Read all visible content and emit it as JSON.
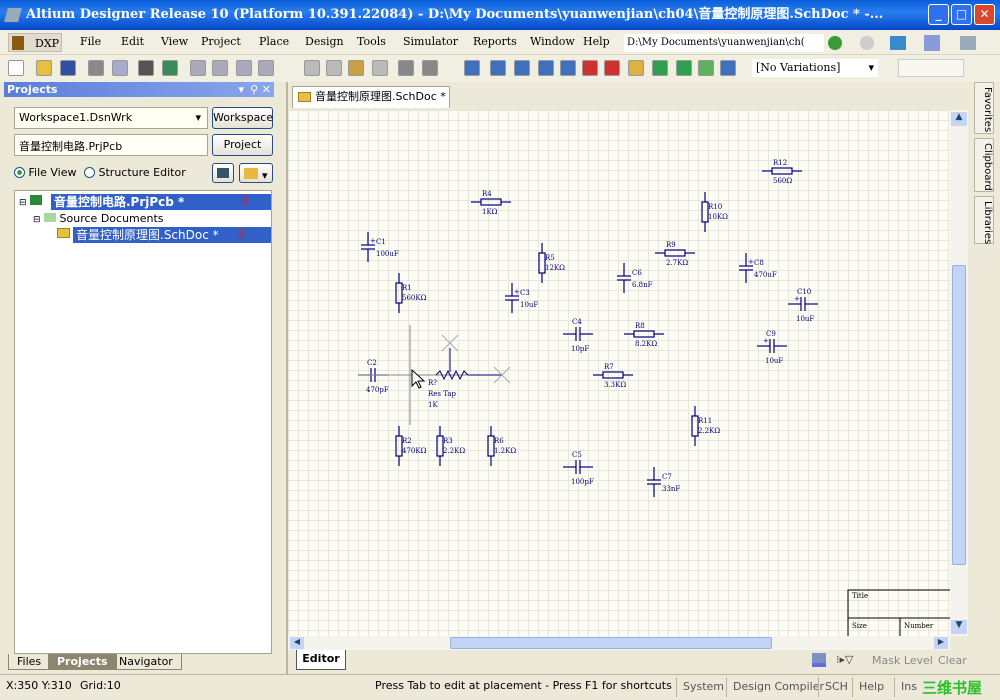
{
  "window": {
    "title": "Altium Designer Release 10 (Platform 10.391.22084) - D:\\My Documents\\yuanwenjian\\ch04\\音量控制原理图.SchDoc * -..."
  },
  "menu": {
    "dxp": "DXP",
    "items": [
      "File",
      "Edit",
      "View",
      "Project",
      "Place",
      "Design",
      "Tools",
      "Simulator",
      "Reports",
      "Window",
      "Help"
    ],
    "path": "D:\\My Documents\\yuanwenjian\\ch("
  },
  "toolbar": {
    "icons": [
      "new-icon",
      "open-icon",
      "save-icon",
      "print-icon",
      "print-preview-icon",
      "3d-icon",
      "board-icon",
      "zoom-fit-icon",
      "zoom-area-icon",
      "zoom-selected-icon",
      "filter-icon",
      "cut-icon",
      "copy-icon",
      "paste-icon",
      "rubber-stamp-icon",
      "select-area-icon",
      "move-icon",
      "wire-icon",
      "bus-icon",
      "bus-entry-icon",
      "net-label-icon",
      "net-icon",
      "gnd-icon",
      "vcc-icon",
      "part-icon",
      "sheet-symbol-icon",
      "sheet-entry-icon",
      "device-sheet-icon",
      "port-icon"
    ],
    "variations": "[No Variations]"
  },
  "projects_panel": {
    "title": "Projects",
    "workspace": "Workspace1.DsnWrk",
    "workspace_btn": "Workspace",
    "project": "音量控制电路.PrjPcb",
    "project_btn": "Project",
    "file_view": "File View",
    "structure_editor": "Structure Editor",
    "tree": {
      "project": "音量控制电路.PrjPcb *",
      "folder": "Source Documents",
      "doc": "音量控制原理图.SchDoc *"
    },
    "tabs": [
      "Files",
      "Projects",
      "Navigator"
    ]
  },
  "document_tab": "音量控制原理图.SchDoc *",
  "side_tabs": [
    "Favorites",
    "Clipboard",
    "Libraries"
  ],
  "schematic": {
    "wire_color": "#000080",
    "components": [
      {
        "ref": "R12",
        "value": "560Ω",
        "type": "resistor",
        "orientation": "h"
      },
      {
        "ref": "R4",
        "value": "1KΩ",
        "type": "resistor",
        "orientation": "h"
      },
      {
        "ref": "R10",
        "value": "10KΩ",
        "type": "resistor",
        "orientation": "v"
      },
      {
        "ref": "C1",
        "value": "100uF",
        "type": "capacitor",
        "orientation": "v",
        "polarized": true
      },
      {
        "ref": "R5",
        "value": "12KΩ",
        "type": "resistor",
        "orientation": "v"
      },
      {
        "ref": "R9",
        "value": "2.7KΩ",
        "type": "resistor",
        "orientation": "h"
      },
      {
        "ref": "C8",
        "value": "470uF",
        "type": "capacitor",
        "orientation": "v",
        "polarized": true
      },
      {
        "ref": "C6",
        "value": "6.8nF",
        "type": "capacitor",
        "orientation": "v",
        "polarized": false
      },
      {
        "ref": "R1",
        "value": "560KΩ",
        "type": "resistor",
        "orientation": "v"
      },
      {
        "ref": "C3",
        "value": "10uF",
        "type": "capacitor",
        "orientation": "v",
        "polarized": true
      },
      {
        "ref": "C10",
        "value": "10uF",
        "type": "capacitor",
        "orientation": "h",
        "polarized": true
      },
      {
        "ref": "C4",
        "value": "10pF",
        "type": "capacitor",
        "orientation": "h",
        "polarized": false
      },
      {
        "ref": "R8",
        "value": "8.2KΩ",
        "type": "resistor",
        "orientation": "h"
      },
      {
        "ref": "C9",
        "value": "10uF",
        "type": "capacitor",
        "orientation": "h",
        "polarized": true
      },
      {
        "ref": "C2",
        "value": "470pF",
        "type": "capacitor",
        "orientation": "h",
        "polarized": false
      },
      {
        "ref": "R7",
        "value": "3.3KΩ",
        "type": "resistor",
        "orientation": "h"
      },
      {
        "ref": "R11",
        "value": "2.2KΩ",
        "type": "resistor",
        "orientation": "v"
      },
      {
        "ref": "R2",
        "value": "470KΩ",
        "type": "resistor",
        "orientation": "v"
      },
      {
        "ref": "R3",
        "value": "2.2KΩ",
        "type": "resistor",
        "orientation": "v"
      },
      {
        "ref": "R6",
        "value": "1.2KΩ",
        "type": "resistor",
        "orientation": "v"
      },
      {
        "ref": "C5",
        "value": "100pF",
        "type": "capacitor",
        "orientation": "h",
        "polarized": false
      },
      {
        "ref": "C7",
        "value": "33nF",
        "type": "capacitor",
        "orientation": "v",
        "polarized": false
      }
    ],
    "floating_part": {
      "ref": "R?",
      "name": "Res Tap",
      "value": "1K"
    },
    "title_block": {
      "title": "Title",
      "size": "Size",
      "number": "Number"
    }
  },
  "editor_row": {
    "tab": "Editor",
    "mask_level": "Mask Level",
    "clear": "Clear"
  },
  "status": {
    "coords": "X:350 Y:310",
    "grid": "Grid:10",
    "hint": "Press Tab to edit at placement - Press F1 for shortcuts",
    "buttons": [
      "System",
      "Design Compiler",
      "SCH",
      "Help",
      "Ins"
    ]
  },
  "watermark": "三维书屋"
}
